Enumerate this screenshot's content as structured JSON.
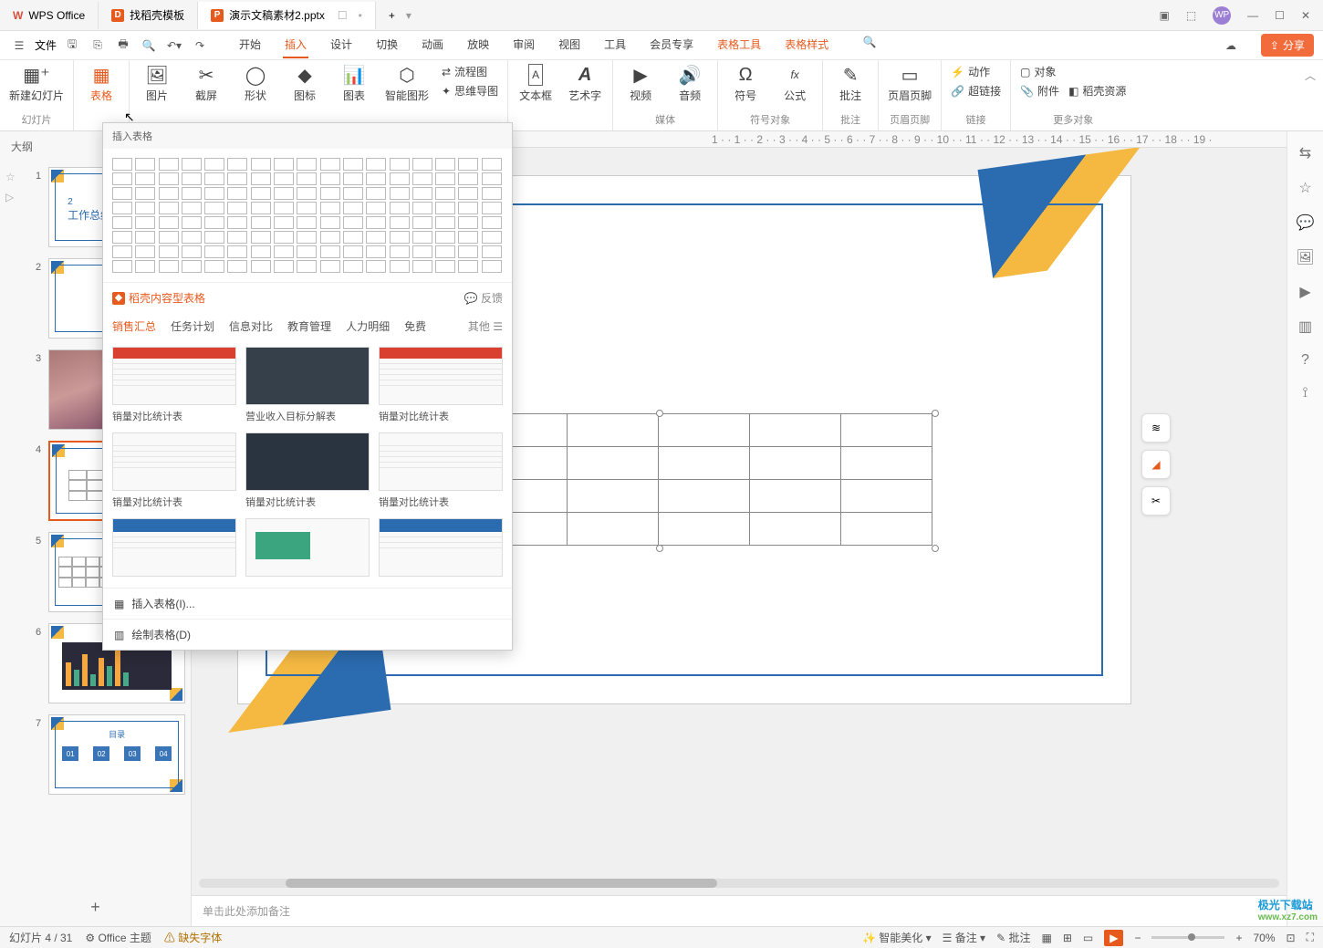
{
  "titlebar": {
    "tabs": [
      {
        "icon": "W",
        "label": "WPS Office"
      },
      {
        "icon": "D",
        "label": "找稻壳模板"
      },
      {
        "icon": "P",
        "label": "演示文稿素材2.pptx"
      }
    ],
    "new_tab": "+",
    "avatar": "WP"
  },
  "quickbar": {
    "file": "文件",
    "menus": [
      "开始",
      "插入",
      "设计",
      "切换",
      "动画",
      "放映",
      "审阅",
      "视图",
      "工具",
      "会员专享",
      "表格工具",
      "表格样式"
    ],
    "active_menu": "插入",
    "share": "分享"
  },
  "ribbon": {
    "groups": [
      {
        "label": "幻灯片",
        "btns": [
          {
            "t": "新建幻灯片",
            "i": "▦"
          }
        ]
      },
      {
        "label": "",
        "btns": [
          {
            "t": "表格",
            "i": "▦",
            "active": true
          }
        ]
      },
      {
        "label": "",
        "btns": [
          {
            "t": "图片",
            "i": "🖼"
          },
          {
            "t": "截屏",
            "i": "✂"
          },
          {
            "t": "形状",
            "i": "◯"
          },
          {
            "t": "图标",
            "i": "◆"
          },
          {
            "t": "图表",
            "i": "📊"
          },
          {
            "t": "智能图形",
            "i": "⬡"
          }
        ],
        "extra": [
          {
            "t": "流程图",
            "i": "⇄"
          },
          {
            "t": "思维导图",
            "i": "✦"
          }
        ]
      },
      {
        "label": "",
        "btns": [
          {
            "t": "文本框",
            "i": "A"
          },
          {
            "t": "艺术字",
            "i": "A"
          }
        ]
      },
      {
        "label": "媒体",
        "btns": [
          {
            "t": "视频",
            "i": "▶"
          },
          {
            "t": "音频",
            "i": "🔊"
          }
        ]
      },
      {
        "label": "符号对象",
        "btns": [
          {
            "t": "符号",
            "i": "Ω"
          },
          {
            "t": "公式",
            "i": "fx"
          }
        ]
      },
      {
        "label": "批注",
        "btns": [
          {
            "t": "批注",
            "i": "✎"
          }
        ]
      },
      {
        "label": "页眉页脚",
        "btns": [
          {
            "t": "页眉页脚",
            "i": "▭"
          }
        ]
      },
      {
        "label": "链接",
        "btns": [],
        "extra": [
          {
            "t": "动作",
            "i": "⚡"
          },
          {
            "t": "超链接",
            "i": "🔗"
          }
        ]
      },
      {
        "label": "更多对象",
        "btns": [],
        "extra": [
          {
            "t": "对象",
            "i": "▢"
          },
          {
            "t": "附件",
            "i": "📎"
          },
          {
            "t": "稻壳资源",
            "i": "◧"
          }
        ]
      }
    ]
  },
  "dropdown": {
    "title": "插入表格",
    "docell_section": "稻壳内容型表格",
    "feedback": "反馈",
    "cats": [
      "销售汇总",
      "任务计划",
      "信息对比",
      "教育管理",
      "人力明细",
      "免费"
    ],
    "active_cat": "销售汇总",
    "more": "其他 ☰",
    "templates": [
      {
        "name": "销量对比统计表",
        "style": "red"
      },
      {
        "name": "营业收入目标分解表",
        "style": "dark"
      },
      {
        "name": "销量对比统计表",
        "style": "red2"
      },
      {
        "name": "销量对比统计表",
        "style": "plain"
      },
      {
        "name": "销量对比统计表",
        "style": "dark2"
      },
      {
        "name": "销量对比统计表",
        "style": "plain2"
      },
      {
        "name": "",
        "style": "blue"
      },
      {
        "name": "",
        "style": "green"
      },
      {
        "name": "",
        "style": "blue2"
      }
    ],
    "action_insert": "插入表格(I)...",
    "action_draw": "绘制表格(D)"
  },
  "sidepanel": {
    "tab_outline": "大纲",
    "slides": [
      {
        "n": "1",
        "type": "title",
        "title": "工作总结"
      },
      {
        "n": "2",
        "type": "blank"
      },
      {
        "n": "3",
        "type": "image"
      },
      {
        "n": "4",
        "type": "table",
        "selected": true
      },
      {
        "n": "5",
        "type": "table2"
      },
      {
        "n": "6",
        "type": "chart"
      },
      {
        "n": "7",
        "type": "boxes",
        "title": "目录",
        "boxes": [
          "01",
          "02",
          "03",
          "04"
        ]
      }
    ]
  },
  "notes_placeholder": "单击此处添加备注",
  "statusbar": {
    "slide_pos": "幻灯片 4 / 31",
    "theme": "Office 主题",
    "missing_font": "缺失字体",
    "smart_beautify": "智能美化",
    "notes": "备注",
    "comments": "批注",
    "zoom": "70%"
  },
  "watermark": {
    "main": "极光下载站",
    "sub": "www.xz7.com"
  }
}
